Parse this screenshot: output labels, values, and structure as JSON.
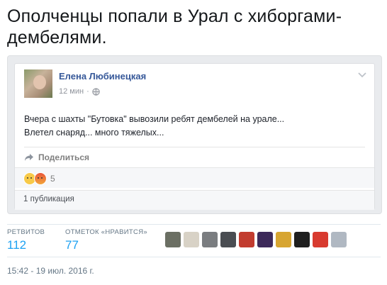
{
  "tweet": {
    "headline": "Ополченцы попали в Урал с хиборгами-дембелями.",
    "timestamp": "15:42 - 19 июл. 2016 г."
  },
  "embed": {
    "author": "Елена Любинецкая",
    "time": "12 мин",
    "audience_icon": "globe-icon",
    "text_line1": "Вчера с шахты \"Бутовка\" вывозили ребят дембелей на урале...",
    "text_line2": "Влетел снаряд... много тяжелых...",
    "share_label": "Поделиться",
    "reactions": [
      "sad-emoji",
      "angry-emoji"
    ],
    "reaction_count": "5",
    "publications": "1 публикация"
  },
  "stats": {
    "retweets_label": "РЕТВИТОВ",
    "retweets_value": "112",
    "likes_label": "ОТМЕТОК «НРАВИТСЯ»",
    "likes_value": "77",
    "liker_avatars": [
      {
        "name": "liker-avatar-1",
        "color": "#6b6f63"
      },
      {
        "name": "liker-avatar-2",
        "color": "#d8d2c6"
      },
      {
        "name": "liker-avatar-3",
        "color": "#7a7d80"
      },
      {
        "name": "liker-avatar-4",
        "color": "#4a4d52"
      },
      {
        "name": "liker-avatar-5",
        "color": "#c23c2f"
      },
      {
        "name": "liker-avatar-6",
        "color": "#3d2a5a"
      },
      {
        "name": "liker-avatar-7",
        "color": "#d7a531"
      },
      {
        "name": "liker-avatar-8",
        "color": "#1f1f1f"
      },
      {
        "name": "liker-avatar-9",
        "color": "#d83a2f"
      },
      {
        "name": "liker-avatar-10",
        "color": "#b0b8c2"
      }
    ]
  }
}
